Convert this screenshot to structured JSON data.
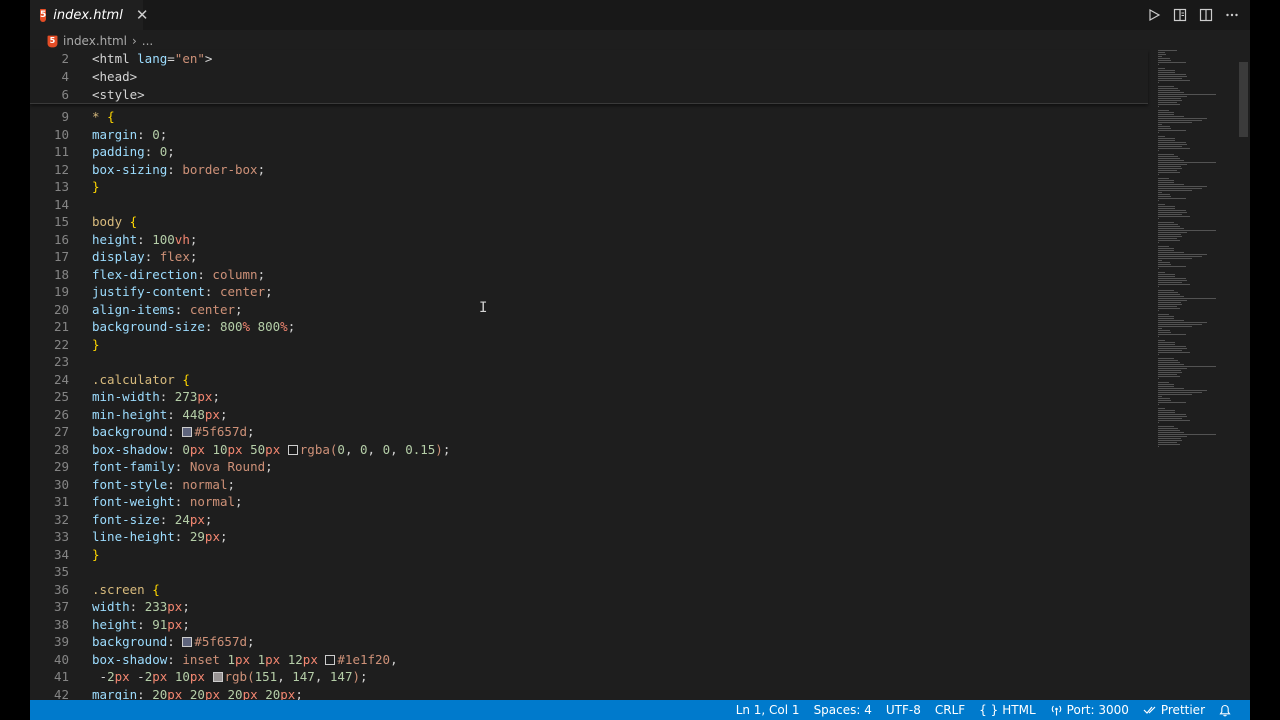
{
  "tab": {
    "icon": "html5-file-icon",
    "label": "index.html",
    "close_glyph": "✕"
  },
  "breadcrumb": {
    "file": "index.html",
    "separator": "›",
    "ellipsis": "..."
  },
  "editor_actions": [
    "run-icon",
    "open-preview-icon",
    "split-editor-icon",
    "more-actions-icon"
  ],
  "sticky_lines": [
    {
      "num": "2",
      "parts": [
        [
          "tag",
          "<html "
        ],
        [
          "attr",
          "lang"
        ],
        [
          "tag",
          "="
        ],
        [
          "str",
          "\"en\""
        ],
        [
          "tag",
          ">"
        ]
      ]
    },
    {
      "num": "4",
      "parts": [
        [
          "tag",
          "<head>"
        ]
      ]
    },
    {
      "num": "6",
      "parts": [
        [
          "tag",
          "<style>"
        ]
      ]
    }
  ],
  "code_lines": [
    {
      "num": "9",
      "parts": [
        [
          "sel",
          "* "
        ],
        [
          "brace",
          "{"
        ]
      ]
    },
    {
      "num": "10",
      "parts": [
        [
          "prop",
          "margin"
        ],
        [
          "punc",
          ": "
        ],
        [
          "num",
          "0"
        ],
        [
          "punc",
          ";"
        ]
      ]
    },
    {
      "num": "11",
      "parts": [
        [
          "prop",
          "padding"
        ],
        [
          "punc",
          ": "
        ],
        [
          "num",
          "0"
        ],
        [
          "punc",
          ";"
        ]
      ]
    },
    {
      "num": "12",
      "parts": [
        [
          "prop",
          "box-sizing"
        ],
        [
          "punc",
          ": "
        ],
        [
          "val",
          "border-box"
        ],
        [
          "punc",
          ";"
        ]
      ]
    },
    {
      "num": "13",
      "parts": [
        [
          "brace",
          "}"
        ]
      ]
    },
    {
      "num": "14",
      "parts": []
    },
    {
      "num": "15",
      "parts": [
        [
          "sel",
          "body "
        ],
        [
          "brace",
          "{"
        ]
      ]
    },
    {
      "num": "16",
      "parts": [
        [
          "prop",
          "height"
        ],
        [
          "punc",
          ": "
        ],
        [
          "num",
          "100"
        ],
        [
          "unit",
          "vh"
        ],
        [
          "punc",
          ";"
        ]
      ]
    },
    {
      "num": "17",
      "parts": [
        [
          "prop",
          "display"
        ],
        [
          "punc",
          ": "
        ],
        [
          "val",
          "flex"
        ],
        [
          "punc",
          ";"
        ]
      ]
    },
    {
      "num": "18",
      "parts": [
        [
          "prop",
          "flex-direction"
        ],
        [
          "punc",
          ": "
        ],
        [
          "val",
          "column"
        ],
        [
          "punc",
          ";"
        ]
      ]
    },
    {
      "num": "19",
      "parts": [
        [
          "prop",
          "justify-content"
        ],
        [
          "punc",
          ": "
        ],
        [
          "val",
          "center"
        ],
        [
          "punc",
          ";"
        ]
      ]
    },
    {
      "num": "20",
      "parts": [
        [
          "prop",
          "align-items"
        ],
        [
          "punc",
          ": "
        ],
        [
          "val",
          "center"
        ],
        [
          "punc",
          ";"
        ]
      ]
    },
    {
      "num": "21",
      "parts": [
        [
          "prop",
          "background-size"
        ],
        [
          "punc",
          ": "
        ],
        [
          "num",
          "800"
        ],
        [
          "unit",
          "%"
        ],
        [
          "punc",
          " "
        ],
        [
          "num",
          "800"
        ],
        [
          "unit",
          "%"
        ],
        [
          "punc",
          ";"
        ]
      ]
    },
    {
      "num": "22",
      "parts": [
        [
          "brace",
          "}"
        ]
      ]
    },
    {
      "num": "23",
      "parts": []
    },
    {
      "num": "24",
      "parts": [
        [
          "sel",
          ".calculator "
        ],
        [
          "brace",
          "{"
        ]
      ]
    },
    {
      "num": "25",
      "parts": [
        [
          "prop",
          "min-width"
        ],
        [
          "punc",
          ": "
        ],
        [
          "num",
          "273"
        ],
        [
          "unit",
          "px"
        ],
        [
          "punc",
          ";"
        ]
      ]
    },
    {
      "num": "26",
      "parts": [
        [
          "prop",
          "min-height"
        ],
        [
          "punc",
          ": "
        ],
        [
          "num",
          "448"
        ],
        [
          "unit",
          "px"
        ],
        [
          "punc",
          ";"
        ]
      ]
    },
    {
      "num": "27",
      "parts": [
        [
          "prop",
          "background"
        ],
        [
          "punc",
          ": "
        ],
        [
          "swatch",
          "#5f657d"
        ],
        [
          "val",
          "#5f657d"
        ],
        [
          "punc",
          ";"
        ]
      ]
    },
    {
      "num": "28",
      "parts": [
        [
          "prop",
          "box-shadow"
        ],
        [
          "punc",
          ": "
        ],
        [
          "num",
          "0"
        ],
        [
          "unit",
          "px"
        ],
        [
          "punc",
          " "
        ],
        [
          "num",
          "10"
        ],
        [
          "unit",
          "px"
        ],
        [
          "punc",
          " "
        ],
        [
          "num",
          "50"
        ],
        [
          "unit",
          "px"
        ],
        [
          "punc",
          " "
        ],
        [
          "swatch",
          "rgba(0,0,0,0.15)"
        ],
        [
          "val",
          "rgba("
        ],
        [
          "num",
          "0"
        ],
        [
          "punc",
          ", "
        ],
        [
          "num",
          "0"
        ],
        [
          "punc",
          ", "
        ],
        [
          "num",
          "0"
        ],
        [
          "punc",
          ", "
        ],
        [
          "num",
          "0.15"
        ],
        [
          "val",
          ")"
        ],
        [
          "punc",
          ";"
        ]
      ]
    },
    {
      "num": "29",
      "parts": [
        [
          "prop",
          "font-family"
        ],
        [
          "punc",
          ": "
        ],
        [
          "val",
          "Nova Round"
        ],
        [
          "punc",
          ";"
        ]
      ]
    },
    {
      "num": "30",
      "parts": [
        [
          "prop",
          "font-style"
        ],
        [
          "punc",
          ": "
        ],
        [
          "val",
          "normal"
        ],
        [
          "punc",
          ";"
        ]
      ]
    },
    {
      "num": "31",
      "parts": [
        [
          "prop",
          "font-weight"
        ],
        [
          "punc",
          ": "
        ],
        [
          "val",
          "normal"
        ],
        [
          "punc",
          ";"
        ]
      ]
    },
    {
      "num": "32",
      "parts": [
        [
          "prop",
          "font-size"
        ],
        [
          "punc",
          ": "
        ],
        [
          "num",
          "24"
        ],
        [
          "unit",
          "px"
        ],
        [
          "punc",
          ";"
        ]
      ]
    },
    {
      "num": "33",
      "parts": [
        [
          "prop",
          "line-height"
        ],
        [
          "punc",
          ": "
        ],
        [
          "num",
          "29"
        ],
        [
          "unit",
          "px"
        ],
        [
          "punc",
          ";"
        ]
      ]
    },
    {
      "num": "34",
      "parts": [
        [
          "brace",
          "}"
        ]
      ]
    },
    {
      "num": "35",
      "parts": []
    },
    {
      "num": "36",
      "parts": [
        [
          "sel",
          ".screen "
        ],
        [
          "brace",
          "{"
        ]
      ]
    },
    {
      "num": "37",
      "parts": [
        [
          "prop",
          "width"
        ],
        [
          "punc",
          ": "
        ],
        [
          "num",
          "233"
        ],
        [
          "unit",
          "px"
        ],
        [
          "punc",
          ";"
        ]
      ]
    },
    {
      "num": "38",
      "parts": [
        [
          "prop",
          "height"
        ],
        [
          "punc",
          ": "
        ],
        [
          "num",
          "91"
        ],
        [
          "unit",
          "px"
        ],
        [
          "punc",
          ";"
        ]
      ]
    },
    {
      "num": "39",
      "parts": [
        [
          "prop",
          "background"
        ],
        [
          "punc",
          ": "
        ],
        [
          "swatch",
          "#5f657d"
        ],
        [
          "val",
          "#5f657d"
        ],
        [
          "punc",
          ";"
        ]
      ]
    },
    {
      "num": "40",
      "parts": [
        [
          "prop",
          "box-shadow"
        ],
        [
          "punc",
          ": "
        ],
        [
          "val",
          "inset "
        ],
        [
          "num",
          "1"
        ],
        [
          "unit",
          "px"
        ],
        [
          "punc",
          " "
        ],
        [
          "num",
          "1"
        ],
        [
          "unit",
          "px"
        ],
        [
          "punc",
          " "
        ],
        [
          "num",
          "12"
        ],
        [
          "unit",
          "px"
        ],
        [
          "punc",
          " "
        ],
        [
          "swatch",
          "#1e1f20"
        ],
        [
          "val",
          "#1e1f20"
        ],
        [
          "punc",
          ","
        ]
      ]
    },
    {
      "num": "41",
      "parts": [
        [
          "punc",
          " -"
        ],
        [
          "num",
          "2"
        ],
        [
          "unit",
          "px"
        ],
        [
          "punc",
          " -"
        ],
        [
          "num",
          "2"
        ],
        [
          "unit",
          "px"
        ],
        [
          "punc",
          " "
        ],
        [
          "num",
          "10"
        ],
        [
          "unit",
          "px"
        ],
        [
          "punc",
          " "
        ],
        [
          "swatch",
          "rgb(151,147,147)"
        ],
        [
          "val",
          "rgb("
        ],
        [
          "num",
          "151"
        ],
        [
          "punc",
          ", "
        ],
        [
          "num",
          "147"
        ],
        [
          "punc",
          ", "
        ],
        [
          "num",
          "147"
        ],
        [
          "val",
          ")"
        ],
        [
          "punc",
          ";"
        ]
      ]
    },
    {
      "num": "42",
      "parts": [
        [
          "prop",
          "margin"
        ],
        [
          "punc",
          ": "
        ],
        [
          "num",
          "20"
        ],
        [
          "unit",
          "px"
        ],
        [
          "punc",
          " "
        ],
        [
          "num",
          "20"
        ],
        [
          "unit",
          "px"
        ],
        [
          "punc",
          " "
        ],
        [
          "num",
          "20"
        ],
        [
          "unit",
          "px"
        ],
        [
          "punc",
          " "
        ],
        [
          "num",
          "20"
        ],
        [
          "unit",
          "px"
        ],
        [
          "punc",
          ";"
        ]
      ]
    }
  ],
  "status": {
    "position": "Ln 1, Col 1",
    "indent": "Spaces: 4",
    "encoding": "UTF-8",
    "eol": "CRLF",
    "language": "HTML",
    "port": "Port: 3000",
    "formatter": "Prettier"
  }
}
